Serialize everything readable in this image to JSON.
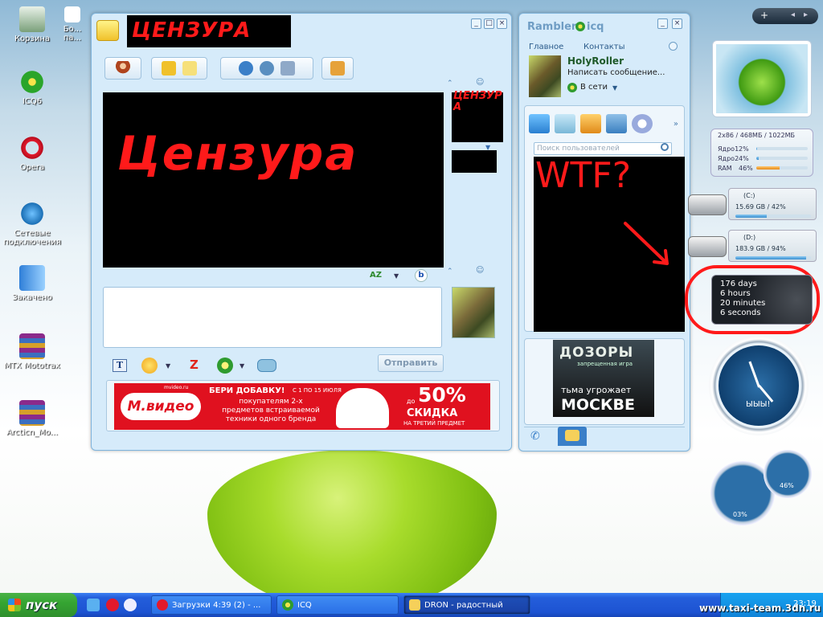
{
  "desktop": {
    "icons": [
      {
        "label": "Корзина"
      },
      {
        "label": "ICQ6"
      },
      {
        "label": "Opera"
      },
      {
        "label": "Сетевые подключения"
      },
      {
        "label": "Закачено"
      },
      {
        "label": "MTX Mototrax"
      },
      {
        "label": "Arcticn_Mo..."
      },
      {
        "label": "Бо... па..."
      }
    ]
  },
  "chat_window": {
    "title_censor": "ЦЕНЗУРА",
    "video_censor": "Цензура",
    "avatar_censor": "ЦЕНЗУРА",
    "send_button": "Отправить",
    "ad": {
      "brand": "М.видео",
      "brand_site": "mvideo.ru",
      "headline": "БЕРИ ДОБАВКУ!",
      "dates": "С 1 ПО 15 ИЮЛЯ",
      "body": "покупателям 2-х предметов встраиваемой техники одного бренда",
      "discount_prefix": "до",
      "discount": "50%",
      "discount_label": "СКИДКА",
      "discount_note": "НА ТРЕТИЙ ПРЕДМЕТ"
    }
  },
  "icq_window": {
    "title": "Rambler",
    "title_brand": "icq",
    "tabs": [
      "Главное",
      "Контакты"
    ],
    "user_name": "HolyRoller",
    "status_message": "Написать сообщение...",
    "presence": "В сети",
    "search_placeholder": "Поиск пользователей",
    "annotation": "WTF?",
    "banner": {
      "title": "ДОЗОРЫ",
      "subtitle": "запрещенная игра",
      "line1": "тьма угрожает",
      "line2": "МОСКВЕ"
    }
  },
  "gadgets": {
    "cpu_header": "2x86 / 468МБ / 1022МБ",
    "cpu_rows": [
      {
        "label": "Ядро1",
        "value": "2%",
        "level": 2
      },
      {
        "label": "Ядро2",
        "value": "4%",
        "level": 4
      },
      {
        "label": "RAM",
        "value": "46%",
        "level": 46
      }
    ],
    "drives": [
      {
        "name": "(C:)",
        "info": "15.69 GB / 42%",
        "level": 42
      },
      {
        "name": "(D:)",
        "info": "183.9 GB / 94%",
        "level": 94
      }
    ],
    "uptime": [
      "176 days",
      "6 hours",
      "20 minutes",
      "6 seconds"
    ],
    "clock_label": "ЫЫЫ!",
    "meter_left": "03%",
    "meter_right": "46%"
  },
  "taskbar": {
    "start": "пуск",
    "tasks": [
      {
        "label": "Загрузки 4:39 (2) - ..."
      },
      {
        "label": "ICQ"
      },
      {
        "label": "DRON - радостный"
      }
    ],
    "tray_time": "23:19"
  },
  "watermark": "www.taxi-team.3dn.ru",
  "colors": {
    "censor_red": "#ff1a1a",
    "window_blue": "#d6ebfa",
    "taskbar": "#245edb"
  }
}
